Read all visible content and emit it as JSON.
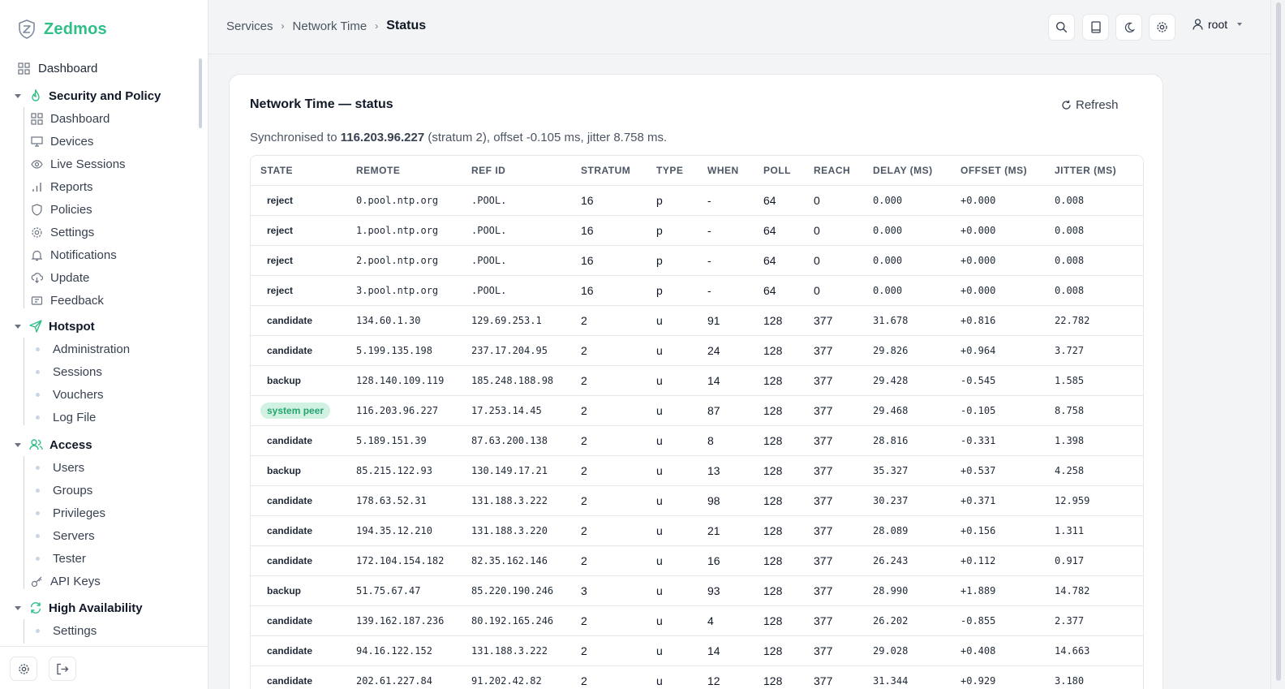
{
  "brand": {
    "name": "Zedmos",
    "accent": "#2fbf87"
  },
  "sidebar": {
    "dashboard": "Dashboard",
    "groups": [
      {
        "label": "Security and Policy",
        "icon": "flame-icon",
        "items": [
          {
            "label": "Dashboard",
            "icon": "grid-icon"
          },
          {
            "label": "Devices",
            "icon": "monitor-icon"
          },
          {
            "label": "Live Sessions",
            "icon": "eye-icon"
          },
          {
            "label": "Reports",
            "icon": "bar-chart-icon"
          },
          {
            "label": "Policies",
            "icon": "shield-icon"
          },
          {
            "label": "Settings",
            "icon": "gear-icon"
          },
          {
            "label": "Notifications",
            "icon": "bell-icon"
          },
          {
            "label": "Update",
            "icon": "cloud-download-icon"
          },
          {
            "label": "Feedback",
            "icon": "ticket-icon"
          }
        ]
      },
      {
        "label": "Hotspot",
        "icon": "send-icon",
        "items": [
          {
            "label": "Administration"
          },
          {
            "label": "Sessions"
          },
          {
            "label": "Vouchers"
          },
          {
            "label": "Log File"
          }
        ]
      },
      {
        "label": "Access",
        "icon": "users-icon",
        "items": [
          {
            "label": "Users"
          },
          {
            "label": "Groups"
          },
          {
            "label": "Privileges"
          },
          {
            "label": "Servers"
          },
          {
            "label": "Tester"
          },
          {
            "label": "API Keys",
            "icon": "key-icon"
          }
        ]
      },
      {
        "label": "High Availability",
        "icon": "sync-icon",
        "items": [
          {
            "label": "Settings"
          }
        ]
      }
    ]
  },
  "breadcrumb": {
    "items": [
      "Services",
      "Network Time"
    ],
    "current": "Status"
  },
  "topbar": {
    "user": "root"
  },
  "card": {
    "title": "Network Time — status",
    "refresh_label": "Refresh",
    "sync": {
      "prefix": "Synchronised to ",
      "peer": "116.203.96.227",
      "suffix": " (stratum 2), offset -0.105 ms, jitter 8.758 ms."
    }
  },
  "table": {
    "columns": [
      "STATE",
      "REMOTE",
      "REF ID",
      "STRATUM",
      "TYPE",
      "WHEN",
      "POLL",
      "REACH",
      "DELAY (MS)",
      "OFFSET (MS)",
      "JITTER (MS)"
    ],
    "rows": [
      [
        "reject",
        "0.pool.ntp.org",
        ".POOL.",
        "16",
        "p",
        "-",
        "64",
        "0",
        "0.000",
        "+0.000",
        "0.008"
      ],
      [
        "reject",
        "1.pool.ntp.org",
        ".POOL.",
        "16",
        "p",
        "-",
        "64",
        "0",
        "0.000",
        "+0.000",
        "0.008"
      ],
      [
        "reject",
        "2.pool.ntp.org",
        ".POOL.",
        "16",
        "p",
        "-",
        "64",
        "0",
        "0.000",
        "+0.000",
        "0.008"
      ],
      [
        "reject",
        "3.pool.ntp.org",
        ".POOL.",
        "16",
        "p",
        "-",
        "64",
        "0",
        "0.000",
        "+0.000",
        "0.008"
      ],
      [
        "candidate",
        "134.60.1.30",
        "129.69.253.1",
        "2",
        "u",
        "91",
        "128",
        "377",
        "31.678",
        "+0.816",
        "22.782"
      ],
      [
        "candidate",
        "5.199.135.198",
        "237.17.204.95",
        "2",
        "u",
        "24",
        "128",
        "377",
        "29.826",
        "+0.964",
        "3.727"
      ],
      [
        "backup",
        "128.140.109.119",
        "185.248.188.98",
        "2",
        "u",
        "14",
        "128",
        "377",
        "29.428",
        "-0.545",
        "1.585"
      ],
      [
        "system peer",
        "116.203.96.227",
        "17.253.14.45",
        "2",
        "u",
        "87",
        "128",
        "377",
        "29.468",
        "-0.105",
        "8.758"
      ],
      [
        "candidate",
        "5.189.151.39",
        "87.63.200.138",
        "2",
        "u",
        "8",
        "128",
        "377",
        "28.816",
        "-0.331",
        "1.398"
      ],
      [
        "backup",
        "85.215.122.93",
        "130.149.17.21",
        "2",
        "u",
        "13",
        "128",
        "377",
        "35.327",
        "+0.537",
        "4.258"
      ],
      [
        "candidate",
        "178.63.52.31",
        "131.188.3.222",
        "2",
        "u",
        "98",
        "128",
        "377",
        "30.237",
        "+0.371",
        "12.959"
      ],
      [
        "candidate",
        "194.35.12.210",
        "131.188.3.220",
        "2",
        "u",
        "21",
        "128",
        "377",
        "28.089",
        "+0.156",
        "1.311"
      ],
      [
        "candidate",
        "172.104.154.182",
        "82.35.162.146",
        "2",
        "u",
        "16",
        "128",
        "377",
        "26.243",
        "+0.112",
        "0.917"
      ],
      [
        "backup",
        "51.75.67.47",
        "85.220.190.246",
        "3",
        "u",
        "93",
        "128",
        "377",
        "28.990",
        "+1.889",
        "14.782"
      ],
      [
        "candidate",
        "139.162.187.236",
        "80.192.165.246",
        "2",
        "u",
        "4",
        "128",
        "377",
        "26.202",
        "-0.855",
        "2.377"
      ],
      [
        "candidate",
        "94.16.122.152",
        "131.188.3.222",
        "2",
        "u",
        "14",
        "128",
        "377",
        "29.028",
        "+0.408",
        "14.663"
      ],
      [
        "candidate",
        "202.61.227.84",
        "91.202.42.82",
        "2",
        "u",
        "12",
        "128",
        "377",
        "31.344",
        "+0.929",
        "3.180"
      ]
    ]
  }
}
